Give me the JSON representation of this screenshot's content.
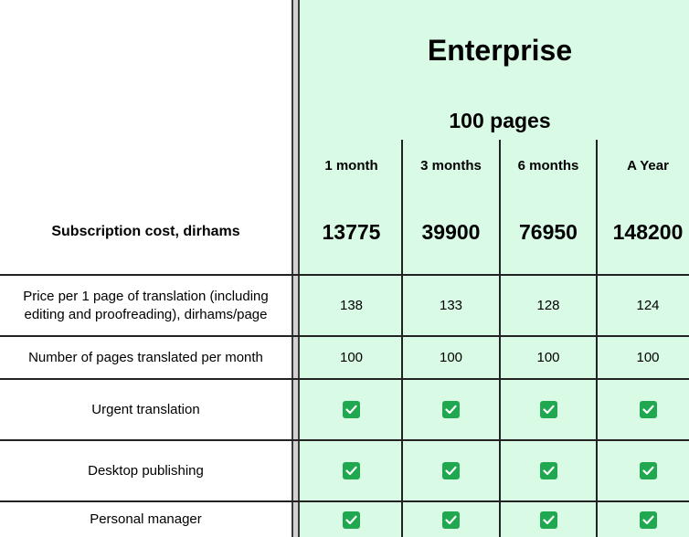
{
  "plan": {
    "name": "Enterprise",
    "pages": "100 pages"
  },
  "periods": [
    "1 month",
    "3 months",
    "6 months",
    "A Year"
  ],
  "cost": {
    "label": "Subscription cost, dirhams",
    "values": [
      "13775",
      "39900",
      "76950",
      "148200"
    ]
  },
  "rows": [
    {
      "label": "Price per 1 page of translation (including editing and proofreading), dirhams/page",
      "values": [
        "138",
        "133",
        "128",
        "124"
      ]
    },
    {
      "label": "Number of pages translated per month",
      "values": [
        "100",
        "100",
        "100",
        "100"
      ]
    },
    {
      "label": "Urgent translation",
      "included": [
        true,
        true,
        true,
        true
      ]
    },
    {
      "label": "Desktop publishing",
      "included": [
        true,
        true,
        true,
        true
      ]
    },
    {
      "label": "Personal manager",
      "included": [
        true,
        true,
        true,
        true
      ]
    }
  ],
  "colors": {
    "plan_background": "#d9fbe6",
    "check_icon": "#1fa84f"
  },
  "icons": {
    "included": "checkbox-checked-icon"
  }
}
